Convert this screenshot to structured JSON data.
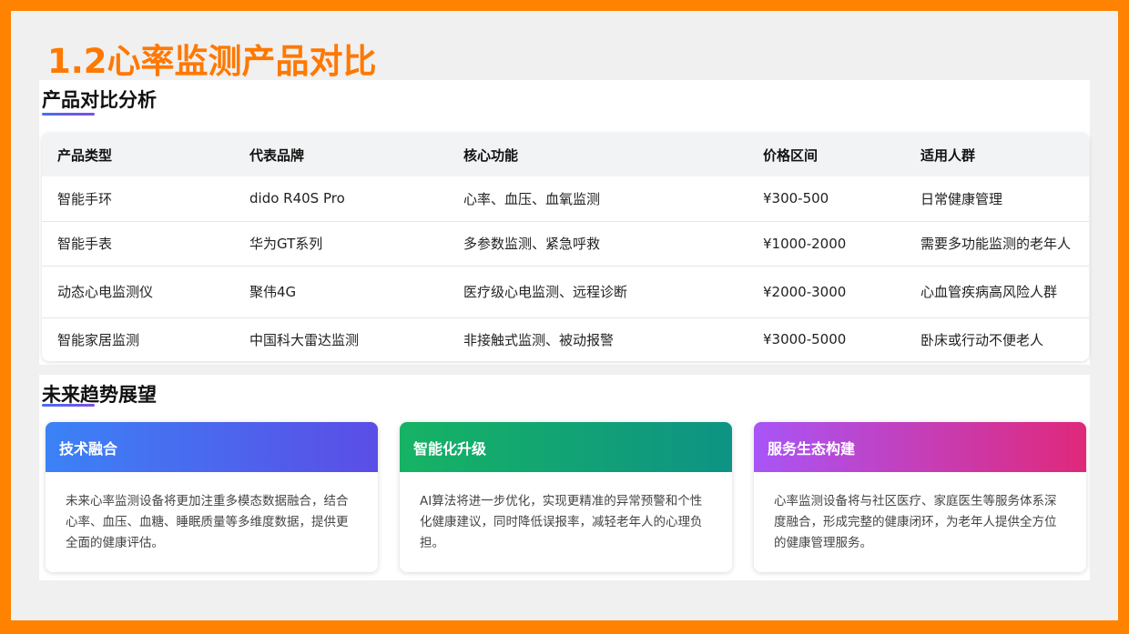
{
  "page": {
    "title": "1.2心率监测产品对比"
  },
  "comparison": {
    "heading": "产品对比分析",
    "columns": [
      "产品类型",
      "代表品牌",
      "核心功能",
      "价格区间",
      "适用人群"
    ],
    "rows": [
      [
        "智能手环",
        "dido R40S Pro",
        "心率、血压、血氧监测",
        "¥300-500",
        "日常健康管理"
      ],
      [
        "智能手表",
        "华为GT系列",
        "多参数监测、紧急呼救",
        "¥1000-2000",
        "需要多功能监测的老年人"
      ],
      [
        "动态心电监测仪",
        "聚伟4G",
        "医疗级心电监测、远程诊断",
        "¥2000-3000",
        "心血管疾病高风险人群"
      ],
      [
        "智能家居监测",
        "中国科大雷达监测",
        "非接触式监测、被动报警",
        "¥3000-5000",
        "卧床或行动不便老人"
      ]
    ]
  },
  "trends": {
    "heading": "未来趋势展望",
    "cards": [
      {
        "title": "技术融合",
        "text": "未来心率监测设备将更加注重多模态数据融合，结合心率、血压、血糖、睡眠质量等多维度数据，提供更全面的健康评估。"
      },
      {
        "title": "智能化升级",
        "text": "AI算法将进一步优化，实现更精准的异常预警和个性化健康建议，同时降低误报率，减轻老年人的心理负担。"
      },
      {
        "title": "服务生态构建",
        "text": "心率监测设备将与社区医疗、家庭医生等服务体系深度融合，形成完整的健康闭环，为老年人提供全方位的健康管理服务。"
      }
    ]
  },
  "colors": {
    "frame": "#FF8200",
    "title": "#FF7800",
    "card1_gradient": [
      "#3B82F6",
      "#5B4DE6"
    ],
    "card2_gradient": [
      "#16B364",
      "#0E9384"
    ],
    "card3_gradient": [
      "#A855F7",
      "#E0287A"
    ]
  }
}
